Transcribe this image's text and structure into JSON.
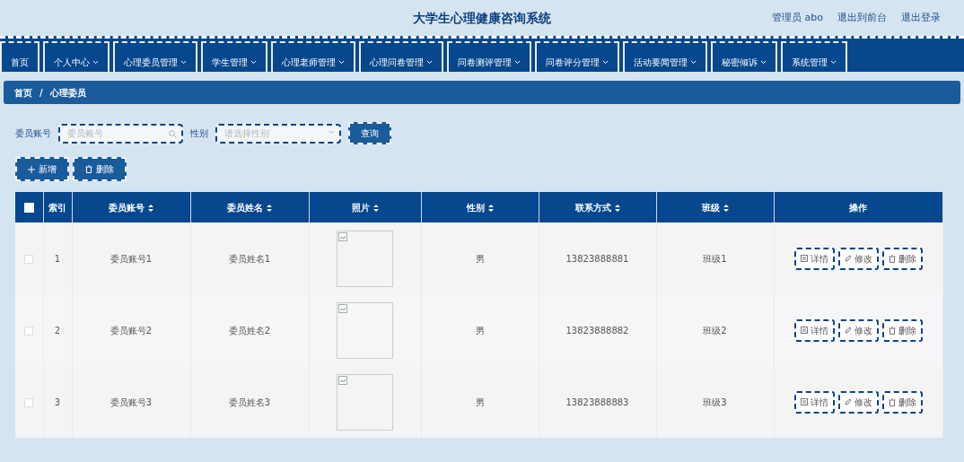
{
  "header": {
    "title": "大学生心理健康咨询系统",
    "user": "管理员 abo",
    "links": [
      "退出到前台",
      "退出登录"
    ]
  },
  "nav": [
    {
      "label": "首页",
      "dropdown": false
    },
    {
      "label": "个人中心",
      "dropdown": true
    },
    {
      "label": "心理委员管理",
      "dropdown": true
    },
    {
      "label": "学生管理",
      "dropdown": true
    },
    {
      "label": "心理老师管理",
      "dropdown": true
    },
    {
      "label": "心理问卷管理",
      "dropdown": true
    },
    {
      "label": "问卷测评管理",
      "dropdown": true
    },
    {
      "label": "问卷评分管理",
      "dropdown": true
    },
    {
      "label": "活动要闻管理",
      "dropdown": true
    },
    {
      "label": "秘密倾诉",
      "dropdown": true
    },
    {
      "label": "系统管理",
      "dropdown": true
    }
  ],
  "breadcrumb": {
    "items": [
      "首页",
      "心理委员"
    ],
    "separator": "/"
  },
  "search": {
    "account_label": "委员账号",
    "account_placeholder": "委员账号",
    "gender_label": "性别",
    "gender_placeholder": "请选择性别",
    "button": "查询"
  },
  "actions": [
    "新增",
    "删除"
  ],
  "table": {
    "columns": [
      {
        "label": "索引",
        "sortable": false,
        "kind": "text"
      },
      {
        "label": "委员账号",
        "sortable": true,
        "kind": "text"
      },
      {
        "label": "委员姓名",
        "sortable": true,
        "kind": "text"
      },
      {
        "label": "照片",
        "sortable": true,
        "kind": "image"
      },
      {
        "label": "性别",
        "sortable": true,
        "kind": "text"
      },
      {
        "label": "联系方式",
        "sortable": true,
        "kind": "text"
      },
      {
        "label": "班级",
        "sortable": true,
        "kind": "text"
      },
      {
        "label": "操作",
        "sortable": false,
        "kind": "actions"
      }
    ],
    "select_all": {
      "checked": false
    },
    "rows": [
      {
        "checked": false,
        "cells": [
          "1",
          "委员账号1",
          "委员姓名1",
          "",
          "男",
          "13823888881",
          "班级1"
        ],
        "buttons": [
          "详情",
          "修改",
          "删除"
        ]
      },
      {
        "checked": false,
        "cells": [
          "2",
          "委员账号2",
          "委员姓名2",
          "",
          "男",
          "13823888882",
          "班级2"
        ],
        "buttons": [
          "详情",
          "修改",
          "删除"
        ]
      },
      {
        "checked": false,
        "cells": [
          "3",
          "委员账号3",
          "委员姓名3",
          "",
          "男",
          "13823888883",
          "班级3"
        ],
        "buttons": [
          "详情",
          "修改",
          "删除"
        ]
      }
    ]
  }
}
